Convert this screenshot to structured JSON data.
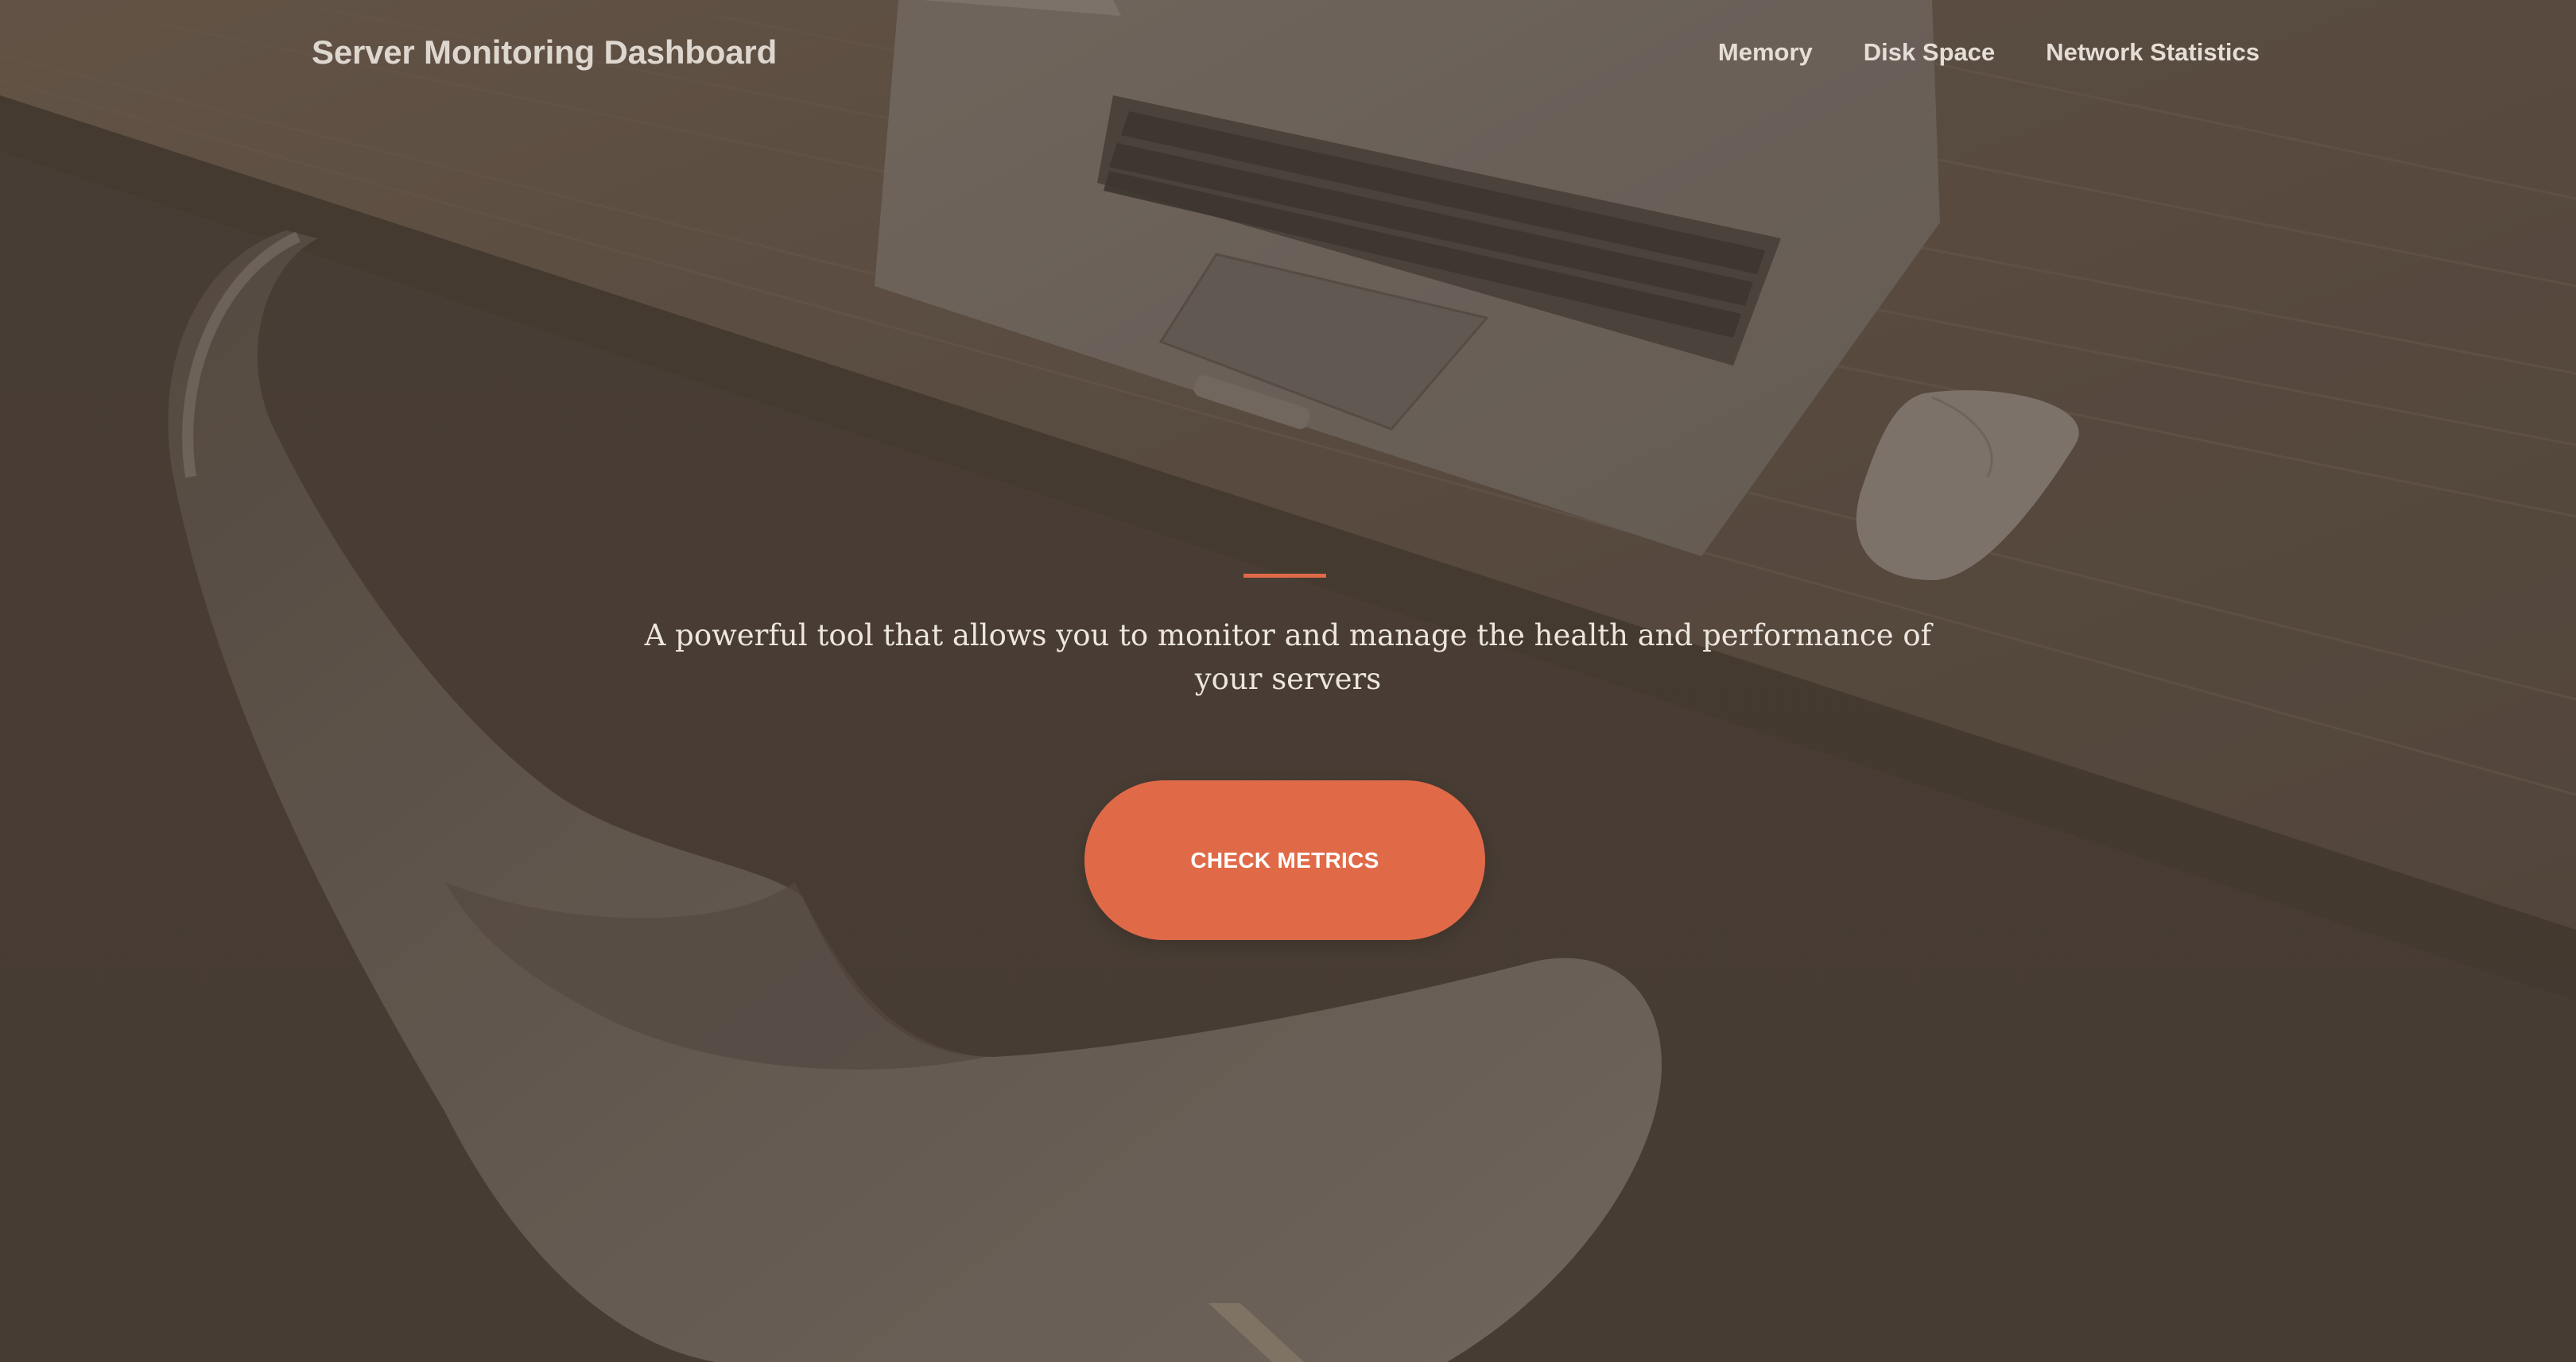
{
  "navbar": {
    "brand": "Server Monitoring Dashboard",
    "links": [
      {
        "label": "Memory"
      },
      {
        "label": "Disk Space"
      },
      {
        "label": "Network Statistics"
      }
    ]
  },
  "hero": {
    "tagline": "A powerful tool that allows you to monitor and manage the health and performance of your servers",
    "cta_label": "CHECK METRICS"
  },
  "colors": {
    "accent": "#e06a47",
    "background": "#4a3f35",
    "text": "#ece6df"
  }
}
